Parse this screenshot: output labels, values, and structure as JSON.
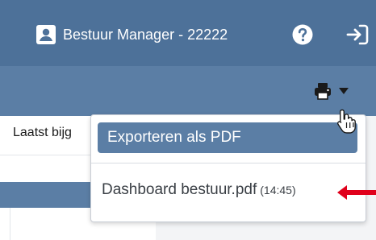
{
  "header": {
    "user_label": "Bestuur Manager - 22222"
  },
  "icons": {
    "user": "user-card-icon",
    "help": "help-icon",
    "logout": "logout-icon",
    "print": "printer-icon",
    "caret": "caret-down-icon",
    "cursor": "hand-pointer-icon",
    "arrow": "red-arrow-icon"
  },
  "main": {
    "left_label": "Laatst bijg"
  },
  "dropdown": {
    "export_label": "Exporteren als PDF",
    "file_name": "Dashboard bestuur.pdf",
    "file_time": "(14:45)"
  },
  "colors": {
    "header_bg": "#4d7199",
    "toolbar_bg": "#5b7ea5",
    "accent": "#5b7ea5",
    "arrow": "#e0001b"
  }
}
